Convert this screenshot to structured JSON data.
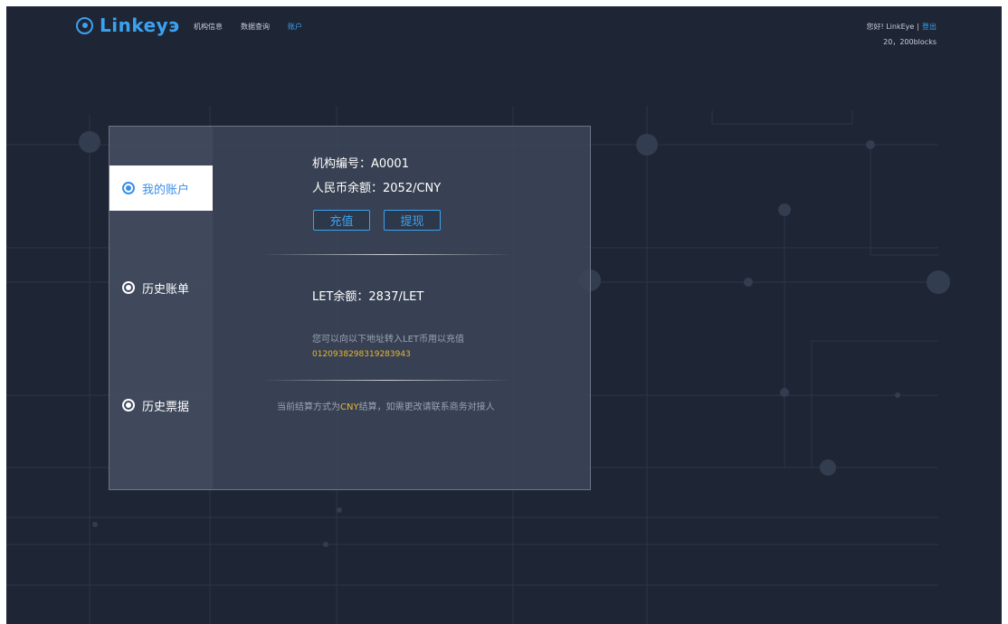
{
  "header": {
    "logo_text": "Linkeyэ",
    "nav": [
      {
        "label": "机构信息"
      },
      {
        "label": "数据查询"
      },
      {
        "label": "账户"
      }
    ],
    "greeting": "您好! LinkEye",
    "separator": "|",
    "logout_label": "登出",
    "blocks": "20，200blocks"
  },
  "sidebar": {
    "items": [
      {
        "label": "我的账户"
      },
      {
        "label": "历史账单"
      },
      {
        "label": "历史票据"
      }
    ]
  },
  "account": {
    "org_line": "机构编号：A0001",
    "cny_line": "人民币余额：2052/CNY",
    "recharge_label": "充值",
    "withdraw_label": "提现",
    "let_line": "LET余额：2837/LET",
    "transfer_hint": "您可以向以下地址转入LET币用以充值",
    "address": "0120938298319283943",
    "notice_prefix": "当前结算方式为",
    "notice_currency": "CNY",
    "notice_suffix": "结算，如需更改请联系商务对接人"
  },
  "colors": {
    "accent": "#3aa3f0",
    "highlight": "#e8b830",
    "background": "#1e2535"
  }
}
